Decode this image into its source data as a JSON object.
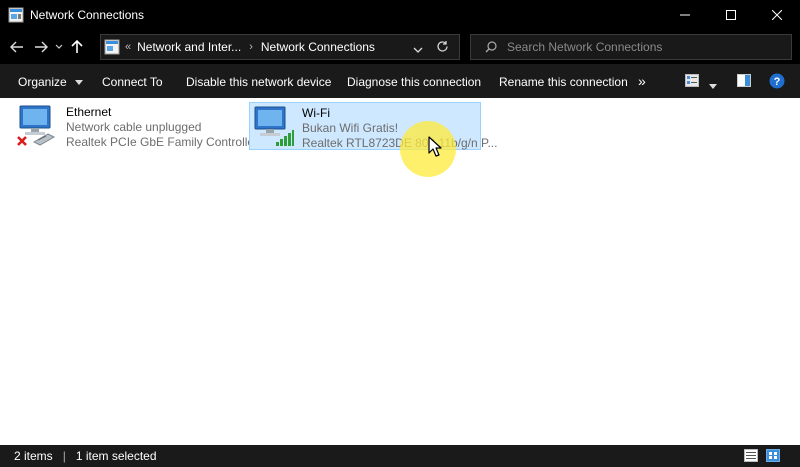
{
  "window": {
    "title": "Network Connections",
    "controls": [
      "minimize",
      "maximize",
      "close"
    ]
  },
  "nav": {
    "breadcrumb_prefix": "«",
    "breadcrumb": [
      "Network and Inter...",
      "Network Connections"
    ],
    "search_placeholder": "Search Network Connections"
  },
  "toolbar": {
    "organize": "Organize",
    "connect_to": "Connect To",
    "disable": "Disable this network device",
    "diagnose": "Diagnose this connection",
    "rename": "Rename this connection",
    "more": "»"
  },
  "connections": [
    {
      "name": "Ethernet",
      "status": "Network cable unplugged",
      "device": "Realtek PCIe GbE Family Controller",
      "selected": false,
      "icon": "ethernet-disconnected-icon"
    },
    {
      "name": "Wi-Fi",
      "status": "Bukan Wifi Gratis!",
      "device": "Realtek RTL8723DE 802.11b/g/n P...",
      "selected": true,
      "icon": "wifi-signal-icon"
    }
  ],
  "status": {
    "item_count": "2 items",
    "selected_count": "1 item selected"
  },
  "colors": {
    "selection_bg": "#cde8ff",
    "selection_border": "#99d1ff",
    "chrome_bg": "#1a1a1a",
    "cursor_highlight": "#ffeb3b"
  }
}
